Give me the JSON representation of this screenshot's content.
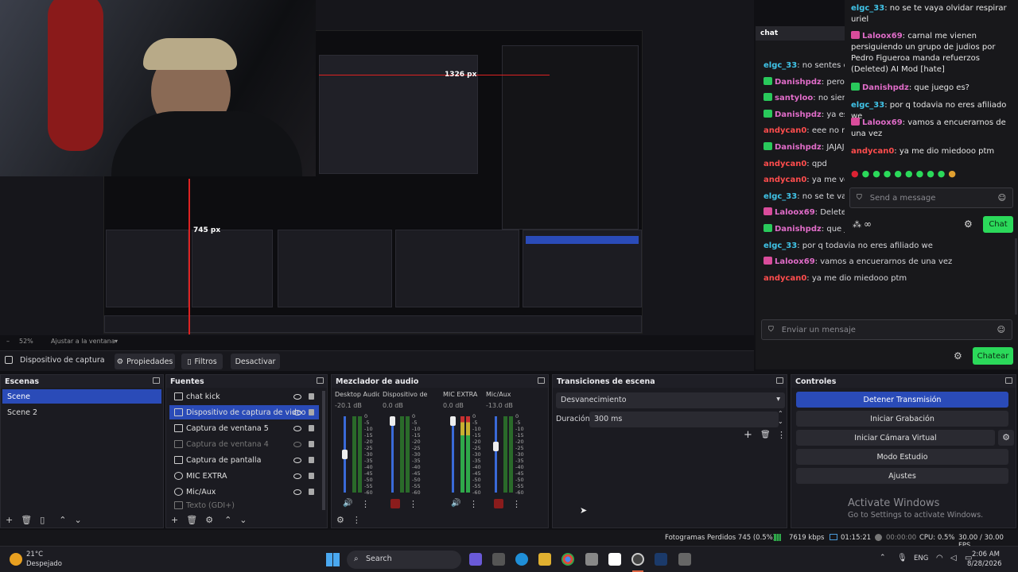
{
  "preview": {
    "nested_labels": [
      "1326 px",
      "745 px"
    ],
    "zoom": "52%",
    "zoom_fit": "Ajustar a la ventana"
  },
  "source_toolbar": {
    "selected_source": "Dispositivo de captura de v",
    "properties": "Propiedades",
    "filters": "Filtros",
    "deactivate": "Desactivar"
  },
  "chat": {
    "header": "chat",
    "messages": [
      {
        "user": "elgc_33",
        "color": "#40c4e8",
        "badge": "",
        "text": ": no sentes qu"
      },
      {
        "user": "Danishpdz",
        "color": "#e06cc8",
        "badge": "green",
        "text": ": pero e"
      },
      {
        "user": "santyloo",
        "color": "#e06cc8",
        "badge": "green",
        "text": ": no siente"
      },
      {
        "user": "Danishpdz",
        "color": "#e06cc8",
        "badge": "green",
        "text": ": ya esta"
      },
      {
        "user": "andycan0",
        "color": "#ff4d4d",
        "badge": "",
        "text": ": eee no me"
      },
      {
        "user": "Danishpdz",
        "color": "#e06cc8",
        "badge": "green",
        "text": ": JAJAJ"
      },
      {
        "user": "andycan0",
        "color": "#ff4d4d",
        "badge": "",
        "text": ": qpd"
      },
      {
        "user": "andycan0",
        "color": "#ff4d4d",
        "badge": "",
        "text": ": ya me voy"
      },
      {
        "user": "elgc_33",
        "color": "#40c4e8",
        "badge": "",
        "text": ": no se te vaya"
      },
      {
        "user": "Laloox69",
        "color": "#e06cc8",
        "badge": "pink",
        "text": ": Deleted b"
      },
      {
        "user": "Danishpdz",
        "color": "#e06cc8",
        "badge": "green",
        "text": ": que juego es?"
      },
      {
        "user": "elgc_33",
        "color": "#40c4e8",
        "badge": "",
        "text": ": por q todavia no eres afiliado we"
      },
      {
        "user": "Laloox69",
        "color": "#e06cc8",
        "badge": "pink",
        "text": ": vamos a encuerarnos de una vez"
      },
      {
        "user": "andycan0",
        "color": "#ff4d4d",
        "badge": "",
        "text": ": ya me dio miedooo ptm"
      }
    ],
    "input_placeholder": "Enviar un mensaje",
    "send_button": "Chatear"
  },
  "overlay_chat": {
    "messages": [
      {
        "user": "elgc_33",
        "color": "#40c4e8",
        "badge": "",
        "text": ": no se te vaya olvidar respirar uriel"
      },
      {
        "user": "Laloox69",
        "color": "#e06cc8",
        "badge": "pink",
        "text": ": carnal me vienen persiguiendo un grupo de judios por Pedro Figueroa manda refuerzos (Deleted) AI Mod [hate]"
      },
      {
        "user": "Danishpdz",
        "color": "#e06cc8",
        "badge": "green",
        "text": ": que juego es?"
      },
      {
        "user": "elgc_33",
        "color": "#40c4e8",
        "badge": "",
        "text": ": por q todavia no eres afiliado we"
      },
      {
        "user": "Laloox69",
        "color": "#e06cc8",
        "badge": "pink",
        "text": ": vamos a encuerarnos de una vez"
      },
      {
        "user": "andycan0",
        "color": "#ff4d4d",
        "badge": "",
        "text": ": ya me dio miedooo ptm"
      }
    ],
    "input_placeholder": "Send a message",
    "send_button": "Chat",
    "points": "∞"
  },
  "scenes": {
    "title": "Escenas",
    "items": [
      "Scene",
      "Scene 2"
    ]
  },
  "sources": {
    "title": "Fuentes",
    "items": [
      "chat kick",
      "Dispositivo de captura de video",
      "Captura de ventana 5",
      "Captura de ventana 4",
      "Captura de pantalla",
      "MIC EXTRA",
      "Mic/Aux",
      "Texto (GDI+)"
    ]
  },
  "mixer": {
    "title": "Mezclador de audio",
    "channels": [
      {
        "name": "Desktop Audio",
        "db": "-20.1 dB"
      },
      {
        "name": "Dispositivo de capt",
        "db": "0.0 dB"
      },
      {
        "name": "MIC EXTRA",
        "db": "0.0 dB"
      },
      {
        "name": "Mic/Aux",
        "db": "-13.0 dB"
      }
    ],
    "ticks": [
      "0",
      "-5",
      "-10",
      "-15",
      "-20",
      "-25",
      "-30",
      "-35",
      "-40",
      "-45",
      "-50",
      "-55",
      "-60"
    ]
  },
  "transitions": {
    "title": "Transiciones de escena",
    "selected": "Desvanecimiento",
    "duration_label": "Duración",
    "duration_value": "300 ms"
  },
  "controls": {
    "title": "Controles",
    "buttons": [
      "Detener Transmisión",
      "Iniciar Grabación",
      "Iniciar Cámara Virtual",
      "Modo Estudio",
      "Ajustes"
    ]
  },
  "watermark": {
    "title": "Activate Windows",
    "subtitle": "Go to Settings to activate Windows."
  },
  "statusbar": {
    "dropped": "Fotogramas Perdidos 745 (0.5%)",
    "bitrate": "7619 kbps",
    "stream_time": "01:15:21",
    "rec_time": "00:00:00",
    "cpu": "CPU: 0.5%",
    "fps": "30.00 / 30.00 FPS"
  },
  "taskbar": {
    "weather_temp": "21°C",
    "weather_desc": "Despejado",
    "search": "Search",
    "lang": "ENG",
    "time": "2:06 AM",
    "date": "8/28/2026"
  }
}
